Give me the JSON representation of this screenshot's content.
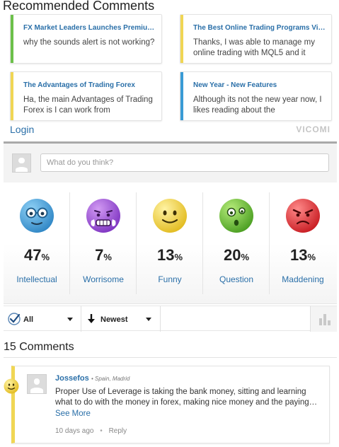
{
  "recommended": {
    "title": "Recommended Comments",
    "cards": [
      {
        "title": "FX Market Leaders Launches Premium…",
        "body": "why the sounds alert is not working?",
        "accent": "#6cc04a"
      },
      {
        "title": "The Best Online Trading Programs Via …",
        "body": "Thanks, I was able to manage my online trading with MQL5 and it",
        "accent": "#f0d654"
      },
      {
        "title": "The Advantages of Trading Forex",
        "body": "Ha, the main Advantages of Trading Forex is I can work from",
        "accent": "#f0d654"
      },
      {
        "title": "New Year - New Features",
        "body": "Although its not the new year now, I likes reading about the",
        "accent": "#3a9bd5"
      }
    ]
  },
  "header": {
    "login": "Login",
    "brand": "VICOMI"
  },
  "compose": {
    "placeholder": "What do you think?"
  },
  "reactions": [
    {
      "value": "47",
      "unit": "%",
      "label": "Intellectual",
      "icon": "intellectual-emoji-icon",
      "color": "#4ba3d9"
    },
    {
      "value": "7",
      "unit": "%",
      "label": "Worrisome",
      "icon": "worrisome-emoji-icon",
      "color": "#a259d9"
    },
    {
      "value": "13",
      "unit": "%",
      "label": "Funny",
      "icon": "funny-emoji-icon",
      "color": "#f1d44a"
    },
    {
      "value": "20",
      "unit": "%",
      "label": "Question",
      "icon": "question-emoji-icon",
      "color": "#6cc04a"
    },
    {
      "value": "13",
      "unit": "%",
      "label": "Maddening",
      "icon": "maddening-emoji-icon",
      "color": "#e2353a"
    }
  ],
  "filters": {
    "filter_label": "All",
    "sort_label": "Newest"
  },
  "comments": {
    "count_label": "15 Comments",
    "items": [
      {
        "author": "Jossefos",
        "location": "• Spain, Madrid",
        "text": "Proper Use of Leverage is taking the bank money, sitting and learning what to do with the money in forex, making nice money and the paying…",
        "see_more": "See More",
        "time": "10 days ago",
        "dot": "•",
        "reply": "Reply",
        "accent": "#f0d654"
      }
    ]
  }
}
